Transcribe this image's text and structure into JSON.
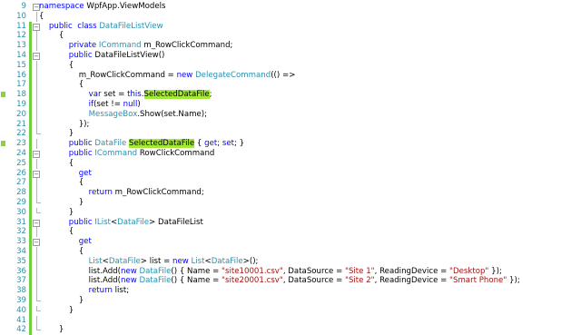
{
  "editor": {
    "lines": [
      {
        "num": "9",
        "marked": false,
        "changed": false,
        "fold": "box",
        "tokens": [
          {
            "t": "namespace ",
            "c": "kw"
          },
          {
            "t": "WpfApp.ViewModels",
            "c": ""
          }
        ]
      },
      {
        "num": "10",
        "marked": false,
        "changed": false,
        "fold": "line",
        "tokens": [
          {
            "t": "{",
            "c": ""
          }
        ]
      },
      {
        "num": "11",
        "marked": false,
        "changed": true,
        "fold": "box",
        "tokens": [
          {
            "t": "    public  class ",
            "c": "kw"
          },
          {
            "t": "DataFileListView",
            "c": "type"
          }
        ]
      },
      {
        "num": "12",
        "marked": false,
        "changed": true,
        "fold": "line",
        "tokens": [
          {
            "t": "        {",
            "c": ""
          }
        ]
      },
      {
        "num": "13",
        "marked": false,
        "changed": true,
        "fold": "line",
        "tokens": [
          {
            "t": "            private ",
            "c": "kw"
          },
          {
            "t": "ICommand",
            "c": "type"
          },
          {
            "t": " m_RowClickCommand;",
            "c": ""
          }
        ]
      },
      {
        "num": "14",
        "marked": false,
        "changed": true,
        "fold": "box",
        "tokens": [
          {
            "t": "            public ",
            "c": "kw"
          },
          {
            "t": "DataFileListView()",
            "c": ""
          }
        ]
      },
      {
        "num": "15",
        "marked": false,
        "changed": true,
        "fold": "line",
        "tokens": [
          {
            "t": "            {",
            "c": ""
          }
        ]
      },
      {
        "num": "16",
        "marked": false,
        "changed": true,
        "fold": "line",
        "tokens": [
          {
            "t": "                m_RowClickCommand = ",
            "c": ""
          },
          {
            "t": "new ",
            "c": "kw"
          },
          {
            "t": "DelegateCommand",
            "c": "type"
          },
          {
            "t": "(() =>",
            "c": ""
          }
        ]
      },
      {
        "num": "17",
        "marked": false,
        "changed": true,
        "fold": "line",
        "tokens": [
          {
            "t": "                {",
            "c": ""
          }
        ]
      },
      {
        "num": "18",
        "marked": true,
        "changed": true,
        "fold": "line",
        "tokens": [
          {
            "t": "                    var ",
            "c": "kw"
          },
          {
            "t": "set = ",
            "c": ""
          },
          {
            "t": "this",
            "c": "kw"
          },
          {
            "t": ".",
            "c": ""
          },
          {
            "t": "SelectedDataFile",
            "c": "hl"
          },
          {
            "t": ";",
            "c": ""
          }
        ]
      },
      {
        "num": "19",
        "marked": false,
        "changed": true,
        "fold": "line",
        "tokens": [
          {
            "t": "                    if",
            "c": "kw"
          },
          {
            "t": "(set != ",
            "c": ""
          },
          {
            "t": "null",
            "c": "kw"
          },
          {
            "t": ")",
            "c": ""
          }
        ]
      },
      {
        "num": "20",
        "marked": false,
        "changed": true,
        "fold": "line",
        "tokens": [
          {
            "t": "                    MessageBox",
            "c": "type"
          },
          {
            "t": ".Show(set.Name);",
            "c": ""
          }
        ]
      },
      {
        "num": "21",
        "marked": false,
        "changed": true,
        "fold": "line",
        "tokens": [
          {
            "t": "                });",
            "c": ""
          }
        ]
      },
      {
        "num": "22",
        "marked": false,
        "changed": true,
        "fold": "end",
        "tokens": [
          {
            "t": "            }",
            "c": ""
          }
        ]
      },
      {
        "num": "23",
        "marked": true,
        "changed": true,
        "fold": "line",
        "tokens": [
          {
            "t": "            public ",
            "c": "kw"
          },
          {
            "t": "DataFile ",
            "c": "type"
          },
          {
            "t": "SelectedDataFile",
            "c": "hl"
          },
          {
            "t": " { ",
            "c": ""
          },
          {
            "t": "get",
            "c": "kw"
          },
          {
            "t": "; ",
            "c": ""
          },
          {
            "t": "set",
            "c": "kw"
          },
          {
            "t": "; }",
            "c": ""
          }
        ]
      },
      {
        "num": "24",
        "marked": false,
        "changed": true,
        "fold": "box",
        "tokens": [
          {
            "t": "            public ",
            "c": "kw"
          },
          {
            "t": "ICommand",
            "c": "type"
          },
          {
            "t": " RowClickCommand",
            "c": ""
          }
        ]
      },
      {
        "num": "25",
        "marked": false,
        "changed": true,
        "fold": "line",
        "tokens": [
          {
            "t": "            {",
            "c": ""
          }
        ]
      },
      {
        "num": "26",
        "marked": false,
        "changed": true,
        "fold": "box",
        "tokens": [
          {
            "t": "                get",
            "c": "kw"
          }
        ]
      },
      {
        "num": "27",
        "marked": false,
        "changed": true,
        "fold": "line",
        "tokens": [
          {
            "t": "                {",
            "c": ""
          }
        ]
      },
      {
        "num": "28",
        "marked": false,
        "changed": true,
        "fold": "line",
        "tokens": [
          {
            "t": "                    return ",
            "c": "kw"
          },
          {
            "t": "m_RowClickCommand;",
            "c": ""
          }
        ]
      },
      {
        "num": "29",
        "marked": false,
        "changed": true,
        "fold": "end",
        "tokens": [
          {
            "t": "                }",
            "c": ""
          }
        ]
      },
      {
        "num": "30",
        "marked": false,
        "changed": true,
        "fold": "end",
        "tokens": [
          {
            "t": "            }",
            "c": ""
          }
        ]
      },
      {
        "num": "31",
        "marked": false,
        "changed": true,
        "fold": "box",
        "tokens": [
          {
            "t": "            public ",
            "c": "kw"
          },
          {
            "t": "IList",
            "c": "type"
          },
          {
            "t": "<",
            "c": ""
          },
          {
            "t": "DataFile",
            "c": "type"
          },
          {
            "t": "> DataFileList",
            "c": ""
          }
        ]
      },
      {
        "num": "32",
        "marked": false,
        "changed": true,
        "fold": "line",
        "tokens": [
          {
            "t": "            {",
            "c": ""
          }
        ]
      },
      {
        "num": "33",
        "marked": false,
        "changed": true,
        "fold": "box",
        "tokens": [
          {
            "t": "                get",
            "c": "kw"
          }
        ]
      },
      {
        "num": "34",
        "marked": false,
        "changed": true,
        "fold": "line",
        "tokens": [
          {
            "t": "                {",
            "c": ""
          }
        ]
      },
      {
        "num": "35",
        "marked": false,
        "changed": true,
        "fold": "line",
        "tokens": [
          {
            "t": "                    List",
            "c": "type"
          },
          {
            "t": "<",
            "c": ""
          },
          {
            "t": "DataFile",
            "c": "type"
          },
          {
            "t": "> list = ",
            "c": ""
          },
          {
            "t": "new ",
            "c": "kw"
          },
          {
            "t": "List",
            "c": "type"
          },
          {
            "t": "<",
            "c": ""
          },
          {
            "t": "DataFile",
            "c": "type"
          },
          {
            "t": ">();",
            "c": ""
          }
        ]
      },
      {
        "num": "36",
        "marked": false,
        "changed": true,
        "fold": "line",
        "tokens": [
          {
            "t": "                    list.Add(",
            "c": ""
          },
          {
            "t": "new ",
            "c": "kw"
          },
          {
            "t": "DataFile",
            "c": "type"
          },
          {
            "t": "() { Name = ",
            "c": ""
          },
          {
            "t": "\"site10001.csv\"",
            "c": "str"
          },
          {
            "t": ", DataSource = ",
            "c": ""
          },
          {
            "t": "\"Site 1\"",
            "c": "str"
          },
          {
            "t": ", ReadingDevice = ",
            "c": ""
          },
          {
            "t": "\"Desktop\"",
            "c": "str"
          },
          {
            "t": " });",
            "c": ""
          }
        ]
      },
      {
        "num": "37",
        "marked": false,
        "changed": true,
        "fold": "line",
        "tokens": [
          {
            "t": "                    list.Add(",
            "c": ""
          },
          {
            "t": "new ",
            "c": "kw"
          },
          {
            "t": "DataFile",
            "c": "type"
          },
          {
            "t": "() { Name = ",
            "c": ""
          },
          {
            "t": "\"site20001.csv\"",
            "c": "str"
          },
          {
            "t": ", DataSource = ",
            "c": ""
          },
          {
            "t": "\"Site 2\"",
            "c": "str"
          },
          {
            "t": ", ReadingDevice = ",
            "c": ""
          },
          {
            "t": "\"Smart Phone\"",
            "c": "str"
          },
          {
            "t": " });",
            "c": ""
          }
        ]
      },
      {
        "num": "38",
        "marked": false,
        "changed": true,
        "fold": "line",
        "tokens": [
          {
            "t": "                    return ",
            "c": "kw"
          },
          {
            "t": "list;",
            "c": ""
          }
        ]
      },
      {
        "num": "39",
        "marked": false,
        "changed": true,
        "fold": "end",
        "tokens": [
          {
            "t": "                }",
            "c": ""
          }
        ]
      },
      {
        "num": "40",
        "marked": false,
        "changed": true,
        "fold": "end",
        "tokens": [
          {
            "t": "            }",
            "c": ""
          }
        ]
      },
      {
        "num": "41",
        "marked": false,
        "changed": true,
        "fold": "line",
        "tokens": [
          {
            "t": "",
            "c": ""
          }
        ]
      },
      {
        "num": "42",
        "marked": false,
        "changed": true,
        "fold": "end",
        "tokens": [
          {
            "t": "        }",
            "c": ""
          }
        ]
      }
    ]
  },
  "colors": {
    "keyword": "#0000ff",
    "type": "#2b91af",
    "string": "#a31515",
    "highlight": "#a6e83a",
    "change_bar": "#6fcf3f",
    "line_number": "#2b91af"
  }
}
